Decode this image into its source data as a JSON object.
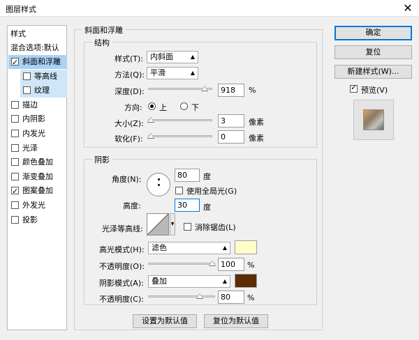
{
  "window": {
    "title": "图层样式",
    "close_glyph": "✕"
  },
  "left_panel": {
    "header": "样式",
    "blend_options": "混合选项:默认",
    "items": [
      {
        "label": "斜面和浮雕",
        "checked": true,
        "selected": true
      },
      {
        "label": "等高线",
        "checked": false,
        "sub": true
      },
      {
        "label": "纹理",
        "checked": false,
        "sub": true
      },
      {
        "label": "描边",
        "checked": false
      },
      {
        "label": "内阴影",
        "checked": false
      },
      {
        "label": "内发光",
        "checked": false
      },
      {
        "label": "光泽",
        "checked": false
      },
      {
        "label": "颜色叠加",
        "checked": false
      },
      {
        "label": "渐变叠加",
        "checked": false
      },
      {
        "label": "图案叠加",
        "checked": true
      },
      {
        "label": "外发光",
        "checked": false
      },
      {
        "label": "投影",
        "checked": false
      }
    ]
  },
  "bevel": {
    "group_title": "斜面和浮雕",
    "structure": {
      "title": "结构",
      "style_label": "样式(T):",
      "style_value": "内斜面",
      "technique_label": "方法(Q):",
      "technique_value": "平滑",
      "depth_label": "深度(D):",
      "depth_value": "918",
      "depth_unit": "%",
      "depth_slider": 0.92,
      "direction_label": "方向:",
      "direction_up": "上",
      "direction_down": "下",
      "size_label": "大小(Z):",
      "size_value": "3",
      "size_unit": "像素",
      "size_slider": 0.0,
      "soften_label": "软化(F):",
      "soften_value": "0",
      "soften_unit": "像素",
      "soften_slider": 0.0
    },
    "shading": {
      "title": "阴影",
      "angle_label": "角度(N):",
      "angle_value": "80",
      "angle_unit": "度",
      "global_light": "使用全局光(G)",
      "altitude_label": "高度:",
      "altitude_value": "30",
      "altitude_unit": "度",
      "gloss_contour_label": "光泽等高线:",
      "anti_alias": "消除锯齿(L)",
      "highlight_mode_label": "高光模式(H):",
      "highlight_mode_value": "滤色",
      "highlight_color": "#ffffcc",
      "highlight_opacity_label": "不透明度(O):",
      "highlight_opacity_value": "100",
      "highlight_opacity_slider": 1.0,
      "percent": "%",
      "shadow_mode_label": "阴影模式(A):",
      "shadow_mode_value": "叠加",
      "shadow_color": "#5b2e04",
      "shadow_opacity_label": "不透明度(C):",
      "shadow_opacity_value": "80",
      "shadow_opacity_slider": 0.8
    },
    "make_default": "设置为默认值",
    "reset_default": "复位为默认值"
  },
  "buttons": {
    "ok": "确定",
    "reset": "复位",
    "new_style": "新建样式(W)...",
    "preview": "预览(V)"
  },
  "colors": {
    "selection": "#a9d2f5",
    "accent": "#0078d7"
  }
}
